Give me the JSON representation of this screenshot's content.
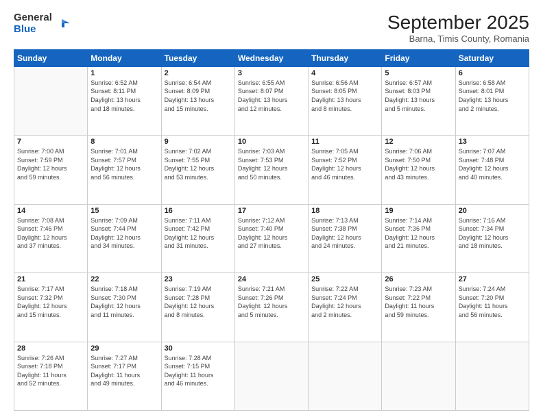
{
  "logo": {
    "line1": "General",
    "line2": "Blue"
  },
  "title": "September 2025",
  "subtitle": "Barna, Timis County, Romania",
  "days_of_week": [
    "Sunday",
    "Monday",
    "Tuesday",
    "Wednesday",
    "Thursday",
    "Friday",
    "Saturday"
  ],
  "weeks": [
    [
      {
        "day": "",
        "detail": ""
      },
      {
        "day": "1",
        "detail": "Sunrise: 6:52 AM\nSunset: 8:11 PM\nDaylight: 13 hours\nand 18 minutes."
      },
      {
        "day": "2",
        "detail": "Sunrise: 6:54 AM\nSunset: 8:09 PM\nDaylight: 13 hours\nand 15 minutes."
      },
      {
        "day": "3",
        "detail": "Sunrise: 6:55 AM\nSunset: 8:07 PM\nDaylight: 13 hours\nand 12 minutes."
      },
      {
        "day": "4",
        "detail": "Sunrise: 6:56 AM\nSunset: 8:05 PM\nDaylight: 13 hours\nand 8 minutes."
      },
      {
        "day": "5",
        "detail": "Sunrise: 6:57 AM\nSunset: 8:03 PM\nDaylight: 13 hours\nand 5 minutes."
      },
      {
        "day": "6",
        "detail": "Sunrise: 6:58 AM\nSunset: 8:01 PM\nDaylight: 13 hours\nand 2 minutes."
      }
    ],
    [
      {
        "day": "7",
        "detail": "Sunrise: 7:00 AM\nSunset: 7:59 PM\nDaylight: 12 hours\nand 59 minutes."
      },
      {
        "day": "8",
        "detail": "Sunrise: 7:01 AM\nSunset: 7:57 PM\nDaylight: 12 hours\nand 56 minutes."
      },
      {
        "day": "9",
        "detail": "Sunrise: 7:02 AM\nSunset: 7:55 PM\nDaylight: 12 hours\nand 53 minutes."
      },
      {
        "day": "10",
        "detail": "Sunrise: 7:03 AM\nSunset: 7:53 PM\nDaylight: 12 hours\nand 50 minutes."
      },
      {
        "day": "11",
        "detail": "Sunrise: 7:05 AM\nSunset: 7:52 PM\nDaylight: 12 hours\nand 46 minutes."
      },
      {
        "day": "12",
        "detail": "Sunrise: 7:06 AM\nSunset: 7:50 PM\nDaylight: 12 hours\nand 43 minutes."
      },
      {
        "day": "13",
        "detail": "Sunrise: 7:07 AM\nSunset: 7:48 PM\nDaylight: 12 hours\nand 40 minutes."
      }
    ],
    [
      {
        "day": "14",
        "detail": "Sunrise: 7:08 AM\nSunset: 7:46 PM\nDaylight: 12 hours\nand 37 minutes."
      },
      {
        "day": "15",
        "detail": "Sunrise: 7:09 AM\nSunset: 7:44 PM\nDaylight: 12 hours\nand 34 minutes."
      },
      {
        "day": "16",
        "detail": "Sunrise: 7:11 AM\nSunset: 7:42 PM\nDaylight: 12 hours\nand 31 minutes."
      },
      {
        "day": "17",
        "detail": "Sunrise: 7:12 AM\nSunset: 7:40 PM\nDaylight: 12 hours\nand 27 minutes."
      },
      {
        "day": "18",
        "detail": "Sunrise: 7:13 AM\nSunset: 7:38 PM\nDaylight: 12 hours\nand 24 minutes."
      },
      {
        "day": "19",
        "detail": "Sunrise: 7:14 AM\nSunset: 7:36 PM\nDaylight: 12 hours\nand 21 minutes."
      },
      {
        "day": "20",
        "detail": "Sunrise: 7:16 AM\nSunset: 7:34 PM\nDaylight: 12 hours\nand 18 minutes."
      }
    ],
    [
      {
        "day": "21",
        "detail": "Sunrise: 7:17 AM\nSunset: 7:32 PM\nDaylight: 12 hours\nand 15 minutes."
      },
      {
        "day": "22",
        "detail": "Sunrise: 7:18 AM\nSunset: 7:30 PM\nDaylight: 12 hours\nand 11 minutes."
      },
      {
        "day": "23",
        "detail": "Sunrise: 7:19 AM\nSunset: 7:28 PM\nDaylight: 12 hours\nand 8 minutes."
      },
      {
        "day": "24",
        "detail": "Sunrise: 7:21 AM\nSunset: 7:26 PM\nDaylight: 12 hours\nand 5 minutes."
      },
      {
        "day": "25",
        "detail": "Sunrise: 7:22 AM\nSunset: 7:24 PM\nDaylight: 12 hours\nand 2 minutes."
      },
      {
        "day": "26",
        "detail": "Sunrise: 7:23 AM\nSunset: 7:22 PM\nDaylight: 11 hours\nand 59 minutes."
      },
      {
        "day": "27",
        "detail": "Sunrise: 7:24 AM\nSunset: 7:20 PM\nDaylight: 11 hours\nand 56 minutes."
      }
    ],
    [
      {
        "day": "28",
        "detail": "Sunrise: 7:26 AM\nSunset: 7:18 PM\nDaylight: 11 hours\nand 52 minutes."
      },
      {
        "day": "29",
        "detail": "Sunrise: 7:27 AM\nSunset: 7:17 PM\nDaylight: 11 hours\nand 49 minutes."
      },
      {
        "day": "30",
        "detail": "Sunrise: 7:28 AM\nSunset: 7:15 PM\nDaylight: 11 hours\nand 46 minutes."
      },
      {
        "day": "",
        "detail": ""
      },
      {
        "day": "",
        "detail": ""
      },
      {
        "day": "",
        "detail": ""
      },
      {
        "day": "",
        "detail": ""
      }
    ]
  ]
}
